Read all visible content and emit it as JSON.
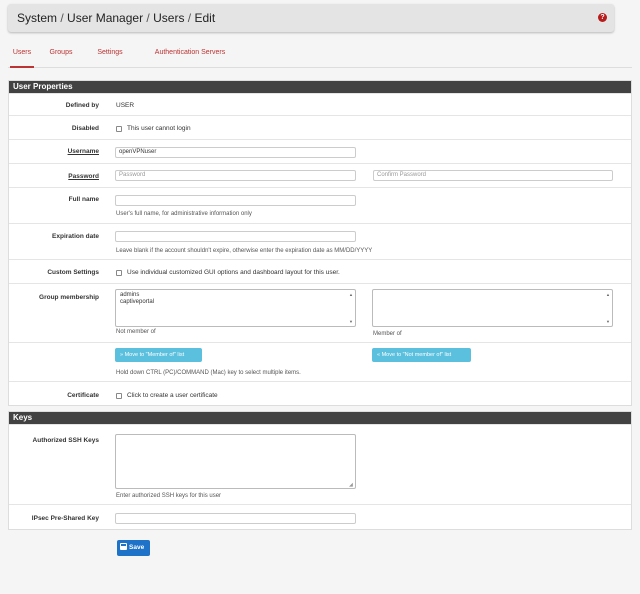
{
  "breadcrumb": {
    "items": [
      "System",
      "User Manager",
      "Users",
      "Edit"
    ],
    "separator": "/"
  },
  "tabs": [
    {
      "label": "Users",
      "active": true
    },
    {
      "label": "Groups",
      "active": false
    },
    {
      "label": "Settings",
      "active": false
    },
    {
      "label": "Authentication Servers",
      "active": false
    }
  ],
  "user_properties": {
    "title": "User Properties",
    "defined_by": {
      "label": "Defined by",
      "value": "USER"
    },
    "disabled": {
      "label": "Disabled",
      "checkbox_label": "This user cannot login",
      "checked": false
    },
    "username": {
      "label": "Username",
      "value": "openVPNuser"
    },
    "password": {
      "label": "Password",
      "placeholder": "Password",
      "confirm_placeholder": "Confirm Password"
    },
    "full_name": {
      "label": "Full name",
      "value": "",
      "help": "User's full name, for administrative information only"
    },
    "expiration": {
      "label": "Expiration date",
      "value": "",
      "help": "Leave blank if the account shouldn't expire, otherwise enter the expiration date as MM/DD/YYYY"
    },
    "custom_settings": {
      "label": "Custom Settings",
      "checkbox_label": "Use individual customized GUI options and dashboard layout for this user.",
      "checked": false
    },
    "group_membership": {
      "label": "Group membership",
      "not_member_options": [
        "admins",
        "captiveportal"
      ],
      "member_options": [],
      "not_member_caption": "Not member of",
      "member_caption": "Member of",
      "move_to_member_label": "Move to \"Member of\" list",
      "move_to_not_member_label": "Move to \"Not member of\" list",
      "help": "Hold down CTRL (PC)/COMMAND (Mac) key to select multiple items."
    },
    "certificate": {
      "label": "Certificate",
      "checkbox_label": "Click to create a user certificate",
      "checked": false
    }
  },
  "keys": {
    "title": "Keys",
    "ssh": {
      "label": "Authorized SSH Keys",
      "value": "",
      "help": "Enter authorized SSH keys for this user"
    },
    "ipsec": {
      "label": "IPsec Pre-Shared Key",
      "value": ""
    }
  },
  "save_label": "Save",
  "colors": {
    "accent": "#b33333",
    "panel_header": "#424242",
    "info_button": "#5bc0de",
    "primary_button": "#1e73c8"
  }
}
